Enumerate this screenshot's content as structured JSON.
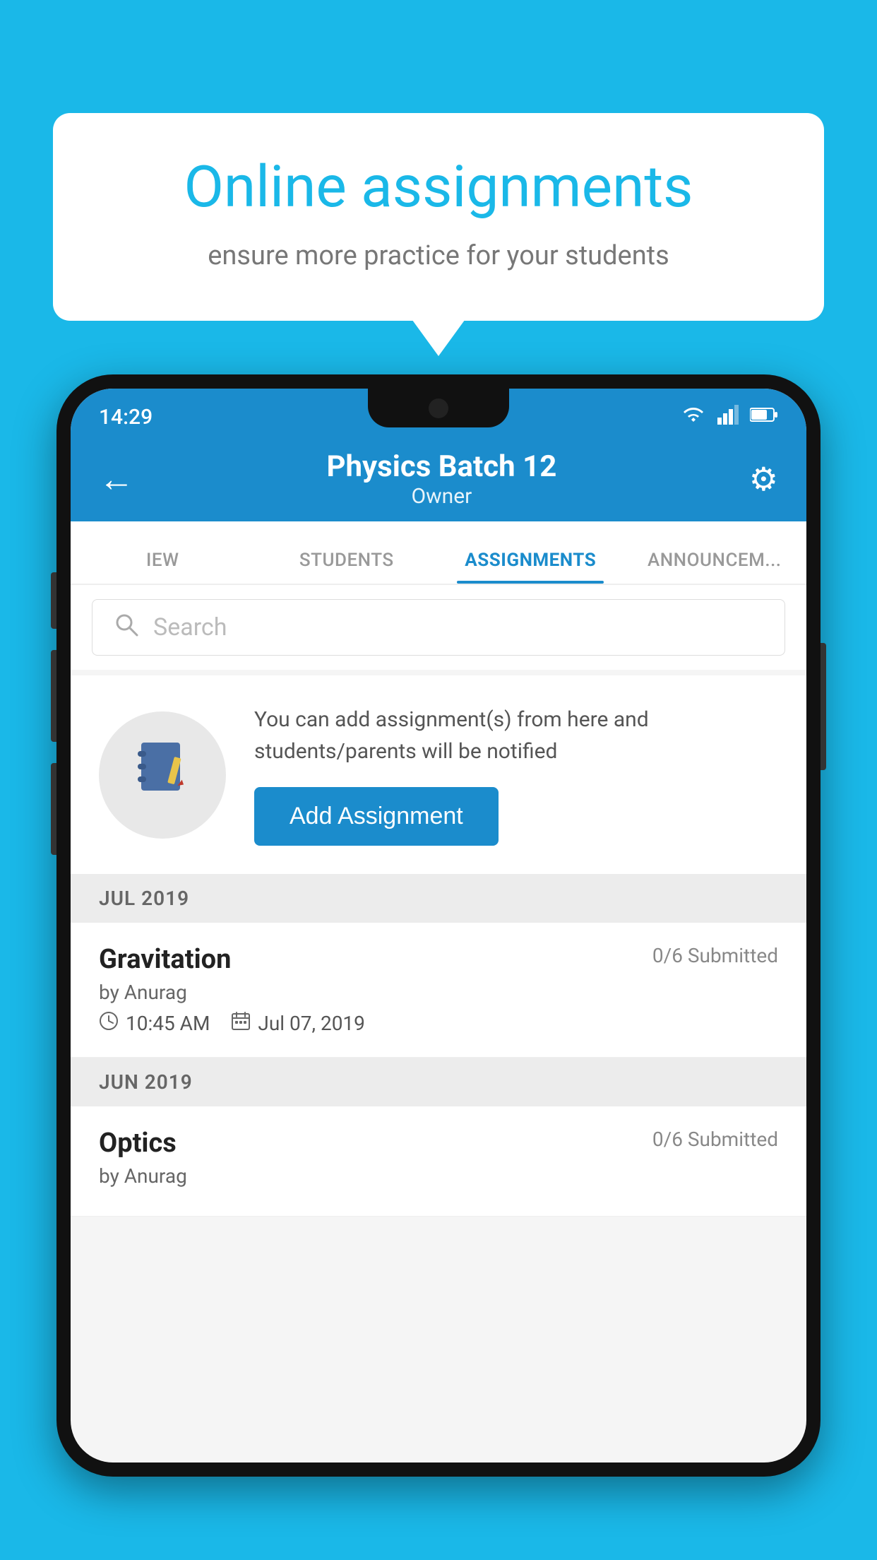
{
  "background_color": "#1ab8e8",
  "speech_bubble": {
    "title": "Online assignments",
    "subtitle": "ensure more practice for your students"
  },
  "phone": {
    "status_bar": {
      "time": "14:29",
      "wifi": "▼",
      "signal": "◀",
      "battery": "▮"
    },
    "header": {
      "title": "Physics Batch 12",
      "subtitle": "Owner",
      "back_icon": "←",
      "gear_icon": "⚙"
    },
    "tabs": [
      {
        "label": "IEW",
        "active": false
      },
      {
        "label": "STUDENTS",
        "active": false
      },
      {
        "label": "ASSIGNMENTS",
        "active": true
      },
      {
        "label": "ANNOUNCEM...",
        "active": false
      }
    ],
    "search": {
      "placeholder": "Search"
    },
    "info_section": {
      "text": "You can add assignment(s) from here and students/parents will be notified",
      "button_label": "Add Assignment"
    },
    "sections": [
      {
        "month_label": "JUL 2019",
        "assignments": [
          {
            "name": "Gravitation",
            "submitted": "0/6 Submitted",
            "by": "by Anurag",
            "time": "10:45 AM",
            "date": "Jul 07, 2019"
          }
        ]
      },
      {
        "month_label": "JUN 2019",
        "assignments": [
          {
            "name": "Optics",
            "submitted": "0/6 Submitted",
            "by": "by Anurag",
            "time": "",
            "date": ""
          }
        ]
      }
    ]
  }
}
